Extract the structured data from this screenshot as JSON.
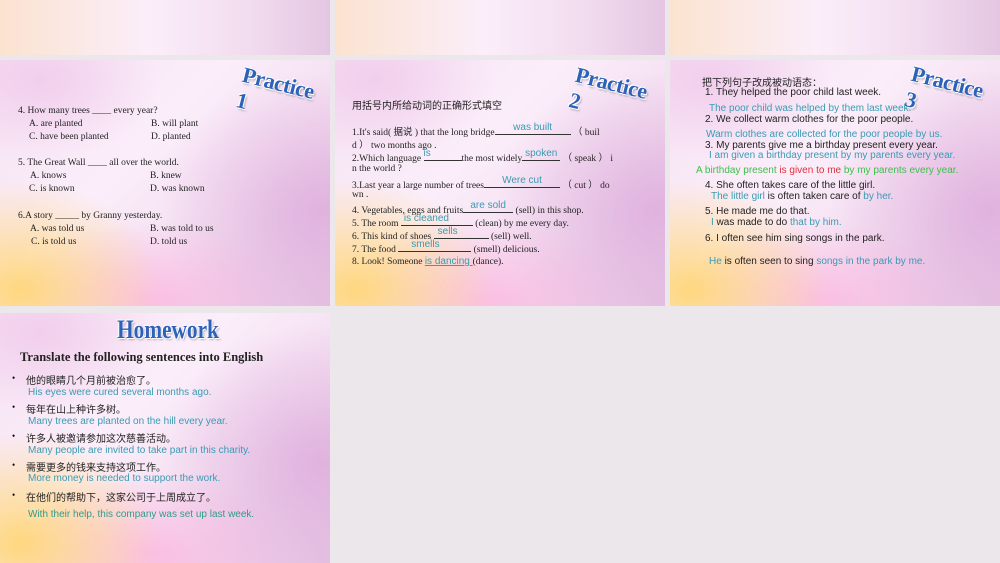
{
  "slides": {
    "practice1": {
      "title": "Practice 1",
      "questions": [
        {
          "q": "4. How many trees ____ every year?",
          "a": "A. are planted",
          "b": "B. will plant",
          "c": "C. have been planted",
          "d": "D. planted"
        },
        {
          "q": "5. The Great Wall ____ all over the world.",
          "a": "A. knows",
          "b": "B. knew",
          "c": "C. is known",
          "d": "D. was known"
        },
        {
          "q": "6.A story _____ by Granny yesterday.",
          "a": "A. was told us",
          "b": "B. was told to us",
          "c": "C. is told us",
          "d": "D. told us"
        }
      ]
    },
    "practice2": {
      "title": "Practice 2",
      "instruction": "用括号内所给动词的正确形式填空",
      "items": [
        {
          "pre": "1.It's said( 据说 ) that the long bridge",
          "answer": "was built",
          "post": " （ buil",
          "cont": "d ） two months ago ."
        },
        {
          "pre": "2.Which language ",
          "answer": "is",
          "mid": "the most widely",
          "answer2": "spoken",
          "post": " （ speak ） i",
          "cont": "n the world ?"
        },
        {
          "pre": "3.Last year a large number of trees",
          "answer": "Were cut",
          "post": " （ cut ） do",
          "cont": "wn ."
        },
        {
          "pre": "4. Vegetables, eggs and fruits",
          "answer": "are sold",
          "post": " (sell) in this shop."
        },
        {
          "pre": "5. The room ",
          "answer": "is cleaned",
          "post": " (clean) by me every day."
        },
        {
          "pre": "6. This kind of shoes ",
          "answer": "sells",
          "post": " (sell) well."
        },
        {
          "pre": "7. The food ",
          "answer": "smells",
          "post": " (smell) delicious."
        },
        {
          "pre": "8. Look! Someone ",
          "answer": "is dancing ",
          "post": "(dance)."
        }
      ]
    },
    "practice3": {
      "title": "Practice 3",
      "instruction": "把下列句子改成被动语态：",
      "q1": "1. They helped the poor child last week.",
      "a1": "The poor child was helped by them last week.",
      "q2": "2. We collect warm clothes for the poor people.",
      "a2": "Warm clothes are collected for the poor people by us.",
      "q3": "3. My parents give me a birthday present every year.",
      "a3": "I am given a birthday present by my parents every year.",
      "a3b": {
        "p1": "A birthday present ",
        "p2": "is given to me",
        "p3": " by my parents every year."
      },
      "q4": "4. She often takes care of the little girl.",
      "a4": {
        "p1": "The little girl",
        "p2": " is often taken care of ",
        "p3": "by her."
      },
      "q5": "5. He made me do that.",
      "a5": {
        "p1": "I",
        "p2": " was made to do ",
        "p3": "that by him."
      },
      "q6": "6. I often see him sing songs in the park.",
      "a6": {
        "p1": "He",
        "p2": " is often seen to sing ",
        "p3": "songs in the park by me."
      }
    },
    "homework": {
      "title": "Homework",
      "subtitle": "Translate the following sentences into English",
      "bullet": "•",
      "items": [
        {
          "zh": "他的眼睛几个月前被治愈了。",
          "en": "His eyes were cured several months ago."
        },
        {
          "zh": "每年在山上种许多树。",
          "en": "Many trees are planted on the hill every year."
        },
        {
          "zh": "许多人被邀请参加这次慈善活动。",
          "en": "Many people are invited to take part in this charity."
        },
        {
          "zh": "需要更多的钱来支持这项工作。",
          "en": "More money is needed to support the work."
        },
        {
          "zh": "在他们的帮助下，这家公司于上周成立了。",
          "en": "With their help, this company was set up last week."
        }
      ]
    }
  }
}
